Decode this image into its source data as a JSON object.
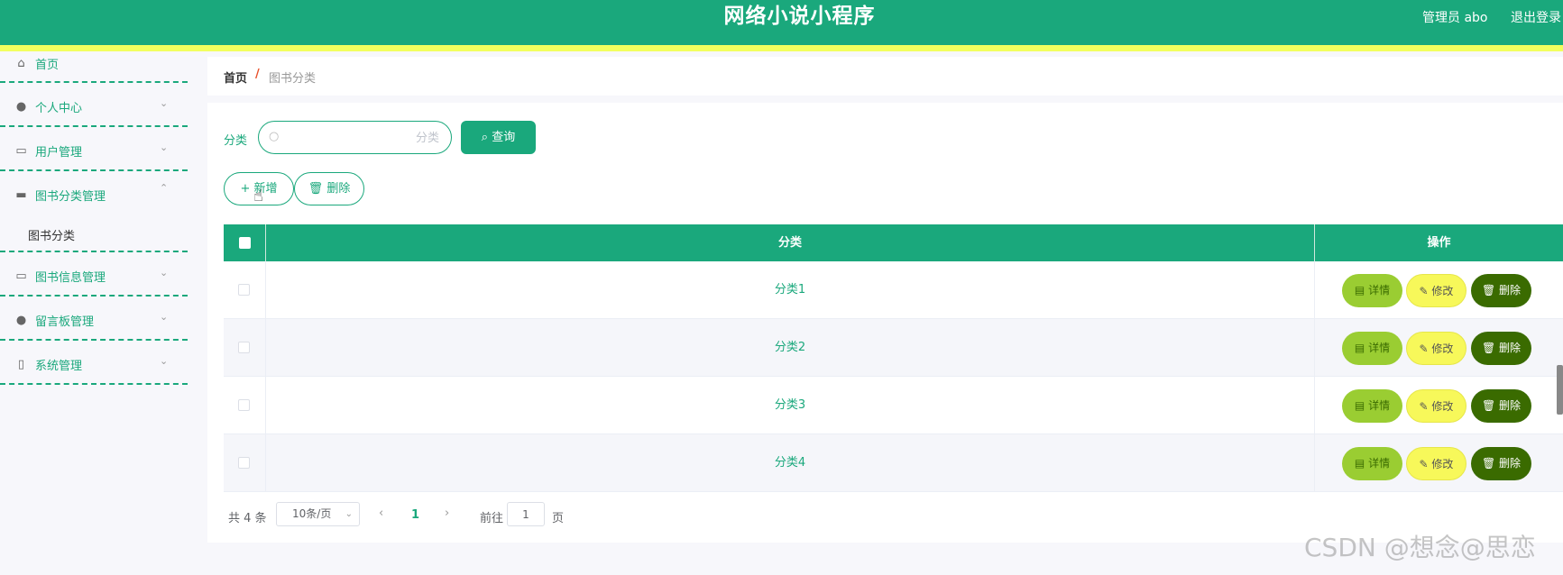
{
  "header": {
    "title": "网络小说小程序",
    "admin": "管理员 abo",
    "logout": "退出登录"
  },
  "sidebar": {
    "items": [
      {
        "label": "首页",
        "icon": "home-icon"
      },
      {
        "label": "个人中心",
        "icon": "user-icon"
      },
      {
        "label": "用户管理",
        "icon": "chat-icon"
      },
      {
        "label": "图书分类管理",
        "icon": "book-icon"
      },
      {
        "label": "图书信息管理",
        "icon": "message-icon"
      },
      {
        "label": "留言板管理",
        "icon": "person-icon"
      },
      {
        "label": "系统管理",
        "icon": "device-icon"
      }
    ],
    "submenu": {
      "label": "图书分类"
    }
  },
  "breadcrumb": {
    "home": "首页",
    "sep": "/",
    "current": "图书分类"
  },
  "search": {
    "label": "分类",
    "placeholder": "分类",
    "button": "查询"
  },
  "actions": {
    "add": "新增",
    "delete": "删除"
  },
  "table": {
    "headers": {
      "category": "分类",
      "operations": "操作"
    },
    "rows": [
      {
        "category": "分类1"
      },
      {
        "category": "分类2"
      },
      {
        "category": "分类3"
      },
      {
        "category": "分类4"
      }
    ],
    "row_actions": {
      "detail": "详情",
      "edit": "修改",
      "delete": "删除"
    }
  },
  "pagination": {
    "total": "共 4 条",
    "page_size": "10条/页",
    "current_page": "1",
    "goto_label": "前往",
    "goto_value": "1",
    "page_suffix": "页"
  },
  "watermark": "CSDN @想念@思恋",
  "colors": {
    "primary": "#1aa87c",
    "accent_strip": "#f2ff5e",
    "detail": "#9acd32",
    "edit": "#f7f85a",
    "delete": "#3a6b00"
  }
}
